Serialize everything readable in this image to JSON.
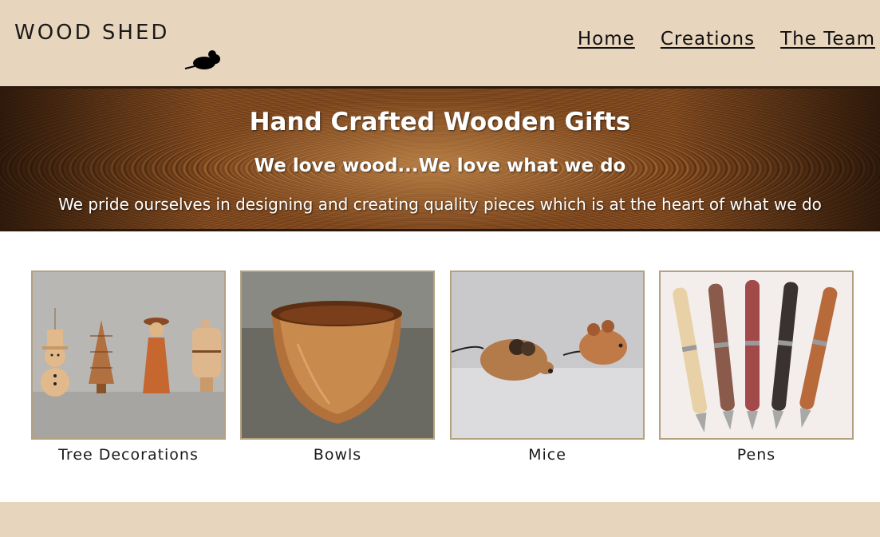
{
  "brand": {
    "name": "WOOD SHED",
    "logo_icon": "mouse-icon"
  },
  "nav": {
    "items": [
      {
        "label": "Home"
      },
      {
        "label": "Creations"
      },
      {
        "label": "The Team"
      }
    ]
  },
  "banner": {
    "title": "Hand Crafted Wooden Gifts",
    "subtitle": "We love wood...We love what we do",
    "tagline": "We pride ourselves in designing and creating quality pieces which is at the heart of what we do"
  },
  "products": [
    {
      "label": "Tree Decorations",
      "image": "tree-decorations-photo"
    },
    {
      "label": "Bowls",
      "image": "bowl-photo"
    },
    {
      "label": "Mice",
      "image": "mice-photo"
    },
    {
      "label": "Pens",
      "image": "pens-photo"
    }
  ],
  "colors": {
    "header_bg": "#e8d5bd",
    "frame_border": "#b3a180",
    "text": "#1a1a1a"
  }
}
